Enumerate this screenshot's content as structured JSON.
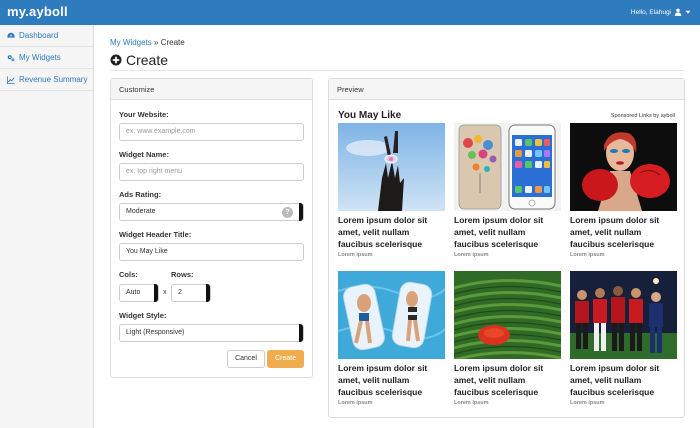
{
  "app": {
    "brand": "my.ayboll",
    "greeting": "Hello, Elahugi"
  },
  "sidebar": {
    "items": [
      {
        "label": "Dashboard",
        "icon": "dashboard-icon"
      },
      {
        "label": "My Widgets",
        "icon": "gears-icon"
      },
      {
        "label": "Revenue Summary",
        "icon": "line-chart-icon"
      }
    ]
  },
  "breadcrumb": {
    "parent": "My Widgets",
    "separator": " » ",
    "current": "Create"
  },
  "page": {
    "title": "Create"
  },
  "customize": {
    "heading": "Customize",
    "website": {
      "label": "Your Website:",
      "placeholder": "ex. www.example.com"
    },
    "widget_name": {
      "label": "Widget Name:",
      "placeholder": "ex. top right menu"
    },
    "ads_rating": {
      "label": "Ads Rating:",
      "value": "Moderate",
      "help": "?"
    },
    "header_title": {
      "label": "Widget Header Title:",
      "value": "You May Like"
    },
    "cols": {
      "label": "Cols:",
      "value": "Auto"
    },
    "rows": {
      "label": "Rows:",
      "value": "2"
    },
    "times": "x",
    "style": {
      "label": "Widget Style:",
      "value": "Light (Responsive)"
    },
    "cancel_label": "Cancel",
    "create_label": "Create"
  },
  "preview": {
    "heading": "Preview",
    "widget_title": "You May Like",
    "sponsored": "Sponsored Links by ayboll",
    "cards": [
      {
        "title": "Lorem ipsum dolor sit amet, velit nullam faucibus scelerisque",
        "source": "Lorem ipsum"
      },
      {
        "title": "Lorem ipsum dolor sit amet, velit nullam faucibus scelerisque",
        "source": "Lorem ipsum"
      },
      {
        "title": "Lorem ipsum dolor sit amet, velit nullam faucibus scelerisque",
        "source": "Lorem ipsum"
      },
      {
        "title": "Lorem ipsum dolor sit amet, velit nullam faucibus scelerisque",
        "source": "Lorem ipsum"
      },
      {
        "title": "Lorem ipsum dolor sit amet, velit nullam faucibus scelerisque",
        "source": "Lorem ipsum"
      },
      {
        "title": "Lorem ipsum dolor sit amet, velit nullam faucibus scelerisque",
        "source": "Lorem ipsum"
      }
    ]
  },
  "colors": {
    "brand": "#2e7bbd",
    "create_button": "#f0ad4e"
  }
}
